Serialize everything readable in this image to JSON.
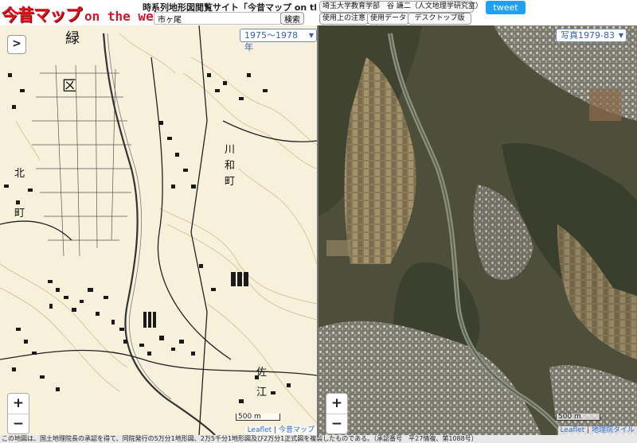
{
  "header": {
    "logo_jp": "今昔マップ",
    "logo_en": "on the web",
    "site_title": "時系列地形図閲覧サイト「今昔マップ on the web」",
    "search": {
      "value": "市ヶ尾",
      "button_label": "検索"
    },
    "author_button": "埼玉大学教育学部　谷 謙二（人文地理学研究室）",
    "usage_notes_button": "使用上の注意",
    "data_button": "使用データ",
    "desktop_button": "デスクトップ版",
    "tweet_label": "tweet"
  },
  "left_map": {
    "expand_label": ">",
    "era_label": "1975〜1978年",
    "zoom_in": "+",
    "zoom_out": "−",
    "scale_label": "500 m",
    "attribution": {
      "leaflet": "Leaflet",
      "separator": " | ",
      "source": "今昔マップ"
    },
    "map_labels": [
      "緑",
      "区",
      "川",
      "和",
      "町",
      "北",
      "町",
      "佐",
      "江"
    ]
  },
  "right_map": {
    "era_label": "写真1979-83",
    "zoom_in": "+",
    "zoom_out": "−",
    "scale_label": "500 m",
    "attribution": {
      "leaflet": "Leaflet",
      "separator": " | ",
      "source": "地理院タイル"
    }
  },
  "footer": {
    "text": "この地図は、国土地理院長の承認を得て、同院発行の5万分1地形図、2万5千分1地形図及び2万分1正式図を複製したものである。（承認番号　平27情複、第1088号）"
  },
  "colors": {
    "accent_red": "#e0141e",
    "tweet_blue": "#1da1f2",
    "select_blue": "#3a5fa6"
  }
}
